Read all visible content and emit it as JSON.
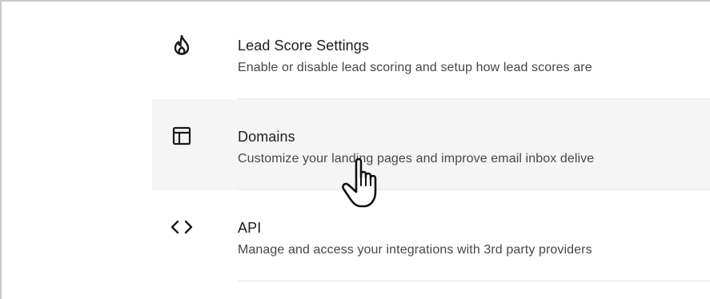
{
  "settings": {
    "items": [
      {
        "icon": "flame-icon",
        "title": "Lead Score Settings",
        "description": "Enable or disable lead scoring and setup how lead scores are"
      },
      {
        "icon": "layout-icon",
        "title": "Domains",
        "description": "Customize your landing pages and improve email inbox delive"
      },
      {
        "icon": "code-icon",
        "title": "API",
        "description": "Manage and access your integrations with 3rd party providers"
      }
    ]
  },
  "colors": {
    "hover_background": "#f5f5f5",
    "divider": "#e6e6e6",
    "title_text": "#1d1d1d",
    "description_text": "#474747"
  }
}
